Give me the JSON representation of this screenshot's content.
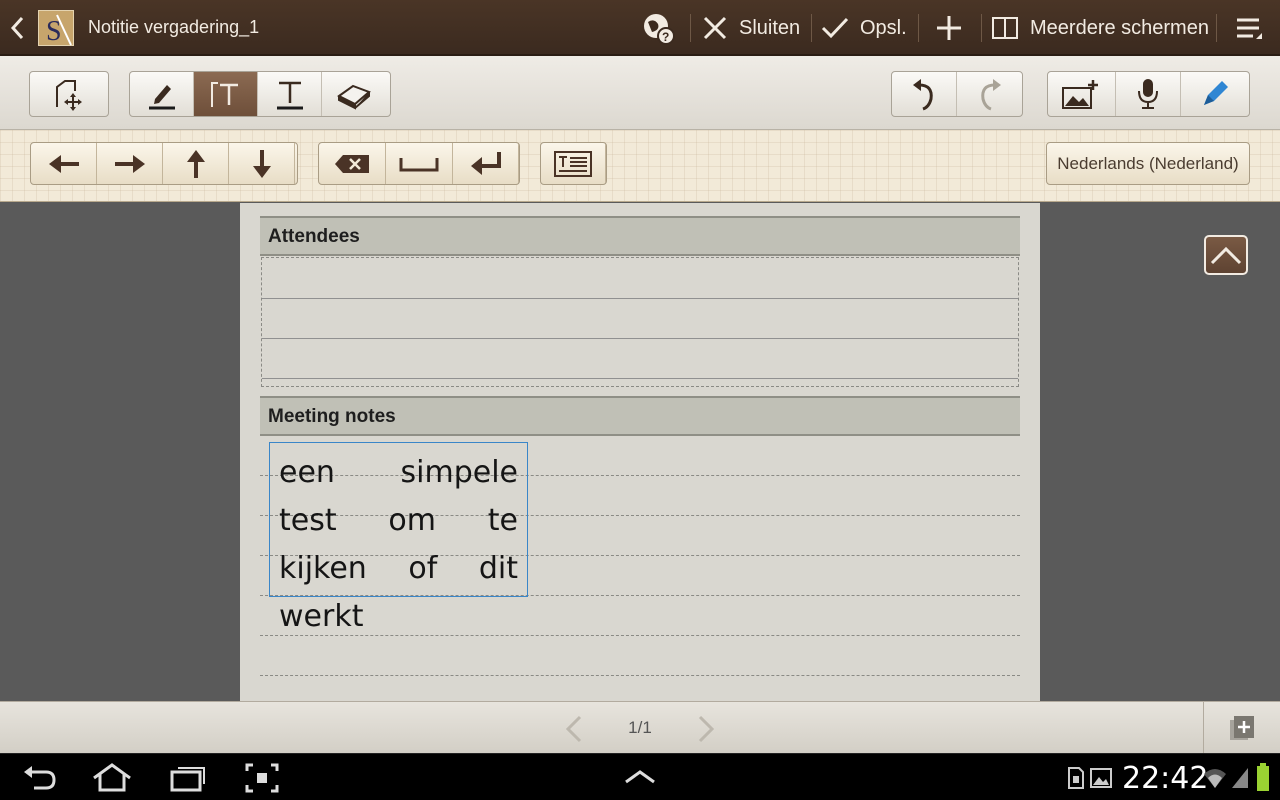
{
  "title_bar": {
    "title": "Notitie vergadering_1",
    "app_icon_letter": "S",
    "close_label": "Sluiten",
    "save_label": "Opsl.",
    "multiscreen_label": "Meerdere schermen"
  },
  "toolbar": {
    "tools": [
      "select-move-icon",
      "pen-icon",
      "text-box-icon",
      "text-icon",
      "eraser-icon"
    ],
    "active_tool": "text-box-icon",
    "right": [
      "undo-icon",
      "redo-icon",
      "insert-image-icon",
      "microphone-icon",
      "pen-settings-icon"
    ]
  },
  "keyboard_bar": {
    "nav": [
      "arrow-left-icon",
      "arrow-right-icon",
      "arrow-up-icon",
      "arrow-down-icon"
    ],
    "edit": [
      "backspace-icon",
      "space-icon",
      "enter-icon"
    ],
    "language": "Nederlands (Nederland)"
  },
  "document": {
    "section_attendees": "Attendees",
    "section_notes": "Meeting notes",
    "note_text": "een simpele test om te kijken of dit werkt"
  },
  "page_bar": {
    "page_indicator": "1/1"
  },
  "system_bar": {
    "time": "22:42"
  },
  "colors": {
    "title_bg": "#3b2a1f",
    "active_tool": "#6e4f3a",
    "accent_blue": "#3a86c8"
  }
}
